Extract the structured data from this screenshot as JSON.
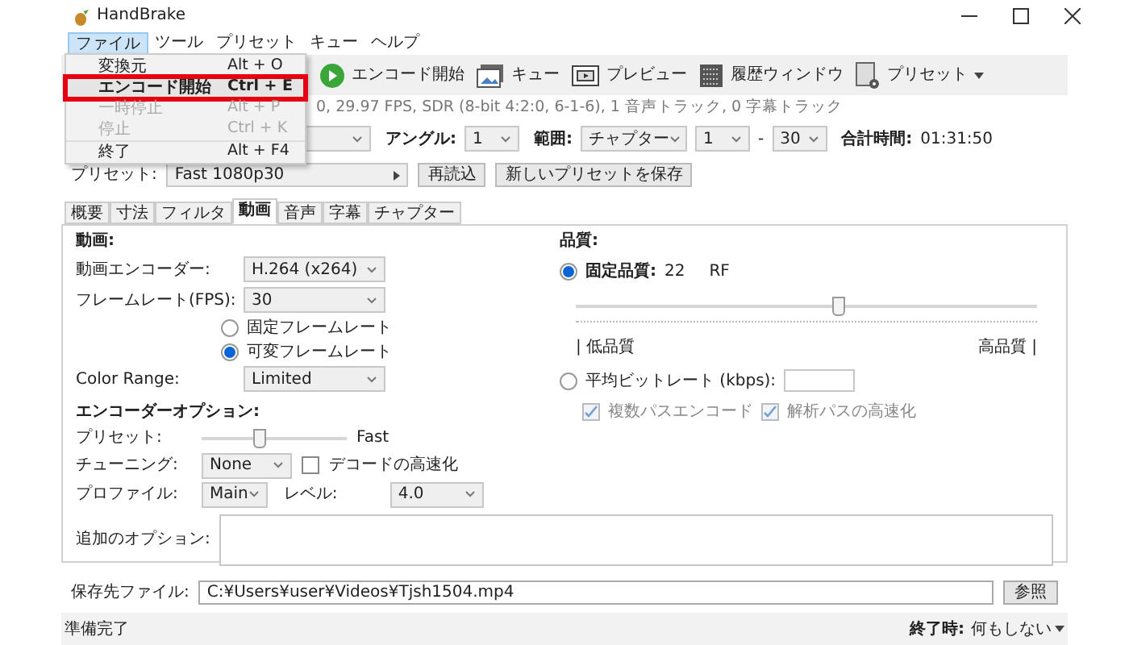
{
  "window": {
    "title": "HandBrake"
  },
  "menu_bar": [
    {
      "label": "ファイル",
      "selected": true
    },
    {
      "label": "ツール",
      "selected": false
    },
    {
      "label": "プリセット",
      "selected": false
    },
    {
      "label": "キュー",
      "selected": false
    },
    {
      "label": "ヘルプ",
      "selected": false
    }
  ],
  "file_menu": [
    {
      "label": "変換元",
      "shortcut": "Alt + O",
      "disabled": false,
      "marked": false
    },
    {
      "label": "エンコード開始",
      "shortcut": "Ctrl + E",
      "disabled": false,
      "marked": true
    },
    {
      "label": "一時停止",
      "shortcut": "Alt + P",
      "disabled": true,
      "marked": false
    },
    {
      "label": "停止",
      "shortcut": "Ctrl + K",
      "disabled": true,
      "marked": false
    },
    {
      "label": "終了",
      "shortcut": "Alt + F4",
      "disabled": false,
      "marked": false
    }
  ],
  "toolbar": [
    {
      "label": "エンコード開始",
      "kind": "play"
    },
    {
      "label": "キュー",
      "kind": "queue"
    },
    {
      "label": "プレビュー",
      "kind": "preview"
    },
    {
      "label": "履歴ウィンドウ",
      "kind": "log"
    },
    {
      "label": "プリセット",
      "kind": "preset"
    }
  ],
  "source_info": "0, 29.97 FPS, SDR (8-bit 4:2:0, 6-1-6), 1 音声トラック, 0 字幕トラック",
  "range_row": {
    "angle_label": "アングル:",
    "angle": "1",
    "range_label": "範囲:",
    "range_type": "チャプター",
    "start": "1",
    "dash": "-",
    "end": "30",
    "duration_label": "合計時間:",
    "duration": "01:31:50"
  },
  "preset_row": {
    "label": "プリセット:",
    "value": "Fast 1080p30",
    "buttons": [
      "再読込",
      "新しいプリセットを保存"
    ]
  },
  "tabs": [
    {
      "label": "概要",
      "selected": false
    },
    {
      "label": "寸法",
      "selected": false
    },
    {
      "label": "フィルタ",
      "selected": false
    },
    {
      "label": "動画",
      "selected": true
    },
    {
      "label": "音声",
      "selected": false
    },
    {
      "label": "字幕",
      "selected": false
    },
    {
      "label": "チャプター",
      "selected": false
    }
  ],
  "video": {
    "heading": "動画:",
    "encoder_label": "動画エンコーダー:",
    "encoder": "H.264 (x264)",
    "framerate_label": "フレームレート(FPS):",
    "framerate": "30",
    "framerate_modes": [
      {
        "label": "固定フレームレート",
        "selected": false
      },
      {
        "label": "可変フレームレート",
        "selected": true
      }
    ],
    "color_range_label": "Color Range:",
    "color_range": "Limited"
  },
  "quality": {
    "heading": "品質:",
    "constant": {
      "label": "固定品質:",
      "selected": true,
      "value": "22",
      "unit": "RF",
      "level": 0.57,
      "low": "| 低品質",
      "high": "高品質 |"
    },
    "bitrate": {
      "label": "平均ビットレート (kbps):",
      "selected": false
    },
    "checkboxes": [
      {
        "label": "複数パスエンコード",
        "checked": true,
        "disabled": true
      },
      {
        "label": "解析パスの高速化",
        "checked": true,
        "disabled": true
      }
    ]
  },
  "encoder_options": {
    "heading": "エンコーダーオプション:",
    "preset_label": "プリセット:",
    "preset_slider": {
      "level": 0.4
    },
    "preset_value": "Fast",
    "tune_label": "チューニング:",
    "tune": "None",
    "fast_decode": {
      "label": "デコードの高速化",
      "checked": false
    },
    "profile_label": "プロファイル:",
    "profile": "Main",
    "level_label": "レベル:",
    "level_value": "4.0",
    "extra_label": "追加のオプション:"
  },
  "destination": {
    "label": "保存先ファイル:",
    "value": "C:¥Users¥user¥Videos¥Tjsh1504.mp4",
    "button": "参照"
  },
  "status_bar": {
    "text": "準備完了",
    "when_done_label": "終了時:",
    "when_done": "何もしない"
  }
}
